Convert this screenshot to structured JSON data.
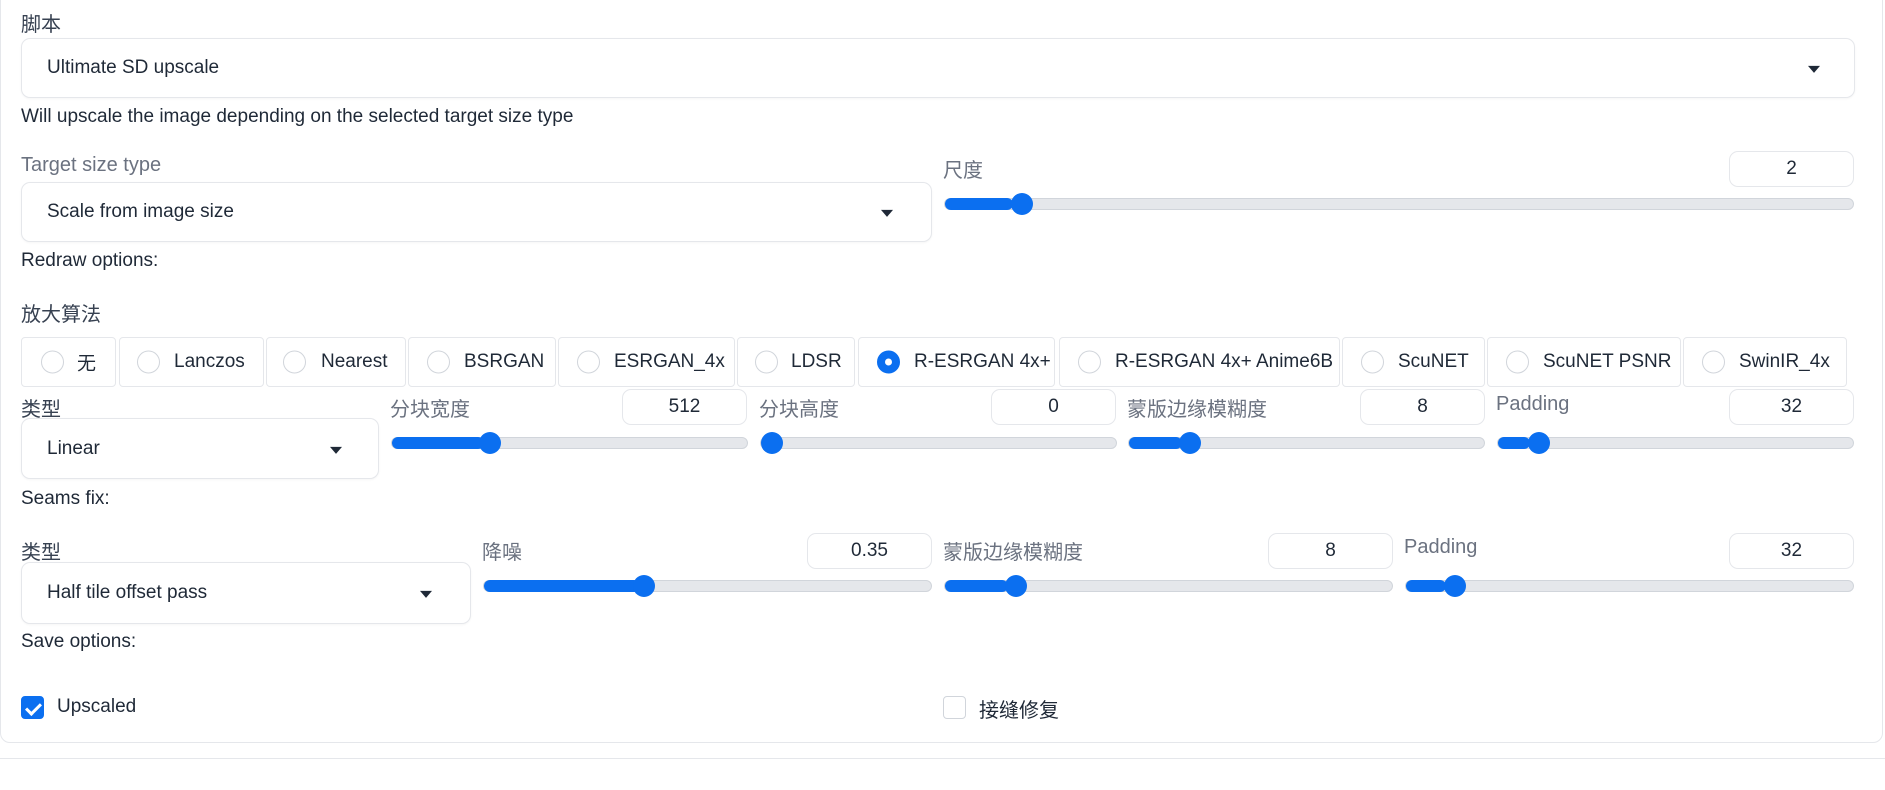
{
  "script": {
    "label": "脚本",
    "selected": "Ultimate SD upscale",
    "description": "Will upscale the image depending on the selected target size type"
  },
  "target": {
    "label": "Target size type",
    "selected": "Scale from image size",
    "scale_label": "尺度",
    "scale_value": "2",
    "scale_fraction": 0.075
  },
  "redraw": {
    "title": "Redraw options:",
    "upscaler_label": "放大算法",
    "upscalers": [
      "无",
      "Lanczos",
      "Nearest",
      "BSRGAN",
      "ESRGAN_4x",
      "LDSR",
      "R-ESRGAN 4x+",
      "R-ESRGAN 4x+ Anime6B",
      "ScuNET",
      "ScuNET PSNR",
      "SwinIR_4x"
    ],
    "selected_upscaler": "R-ESRGAN 4x+",
    "type_label": "类型",
    "type_selected": "Linear",
    "tile_width_label": "分块宽度",
    "tile_width_value": "512",
    "tile_width_fraction": 0.26,
    "tile_height_label": "分块高度",
    "tile_height_value": "0",
    "tile_height_fraction": 0.0,
    "mask_blur_label": "蒙版边缘模糊度",
    "mask_blur_value": "8",
    "mask_blur_fraction": 0.15,
    "padding_label": "Padding",
    "padding_value": "32",
    "padding_fraction": 0.09
  },
  "seams": {
    "title": "Seams fix:",
    "type_label": "类型",
    "type_selected": "Half tile offset pass",
    "denoise_label": "降噪",
    "denoise_value": "0.35",
    "denoise_fraction": 0.35,
    "mask_blur_label": "蒙版边缘模糊度",
    "mask_blur_value": "8",
    "mask_blur_fraction": 0.14,
    "padding_label": "Padding",
    "padding_value": "32",
    "padding_fraction": 0.09
  },
  "save": {
    "title": "Save options:",
    "upscaled_label": "Upscaled",
    "upscaled_checked": true,
    "seams_fix_label": "接缝修复",
    "seams_fix_checked": false
  },
  "colors": {
    "accent": "#0b6ff0",
    "border": "#e5e7eb",
    "label": "#6b7280"
  }
}
